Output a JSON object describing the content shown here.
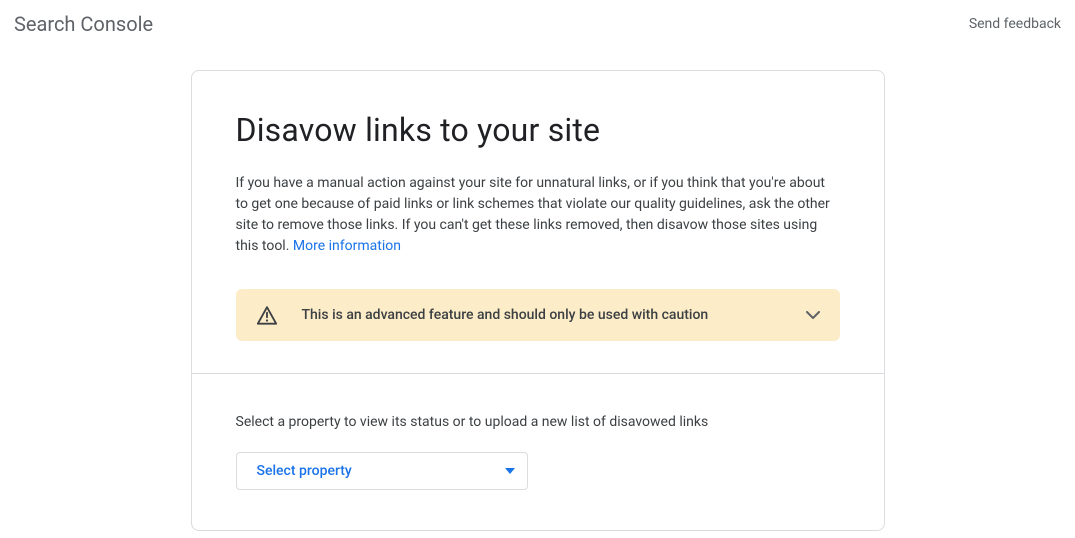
{
  "header": {
    "app_title": "Search Console",
    "feedback_label": "Send feedback"
  },
  "main": {
    "heading": "Disavow links to your site",
    "description": "If you have a manual action against your site for unnatural links, or if you think that you're about to get one because of paid links or link schemes that violate our quality guidelines, ask the other site to remove those links. If you can't get these links removed, then disavow those sites using this tool.",
    "more_info_label": "More information",
    "warning": {
      "text": "This is an advanced feature and should only be used with caution"
    },
    "select": {
      "label": "Select a property to view its status or to upload a new list of disavowed links",
      "placeholder": "Select property"
    }
  },
  "colors": {
    "accent": "#1a73e8",
    "warning_bg": "#fdecc8",
    "border": "#dadce0",
    "text_primary": "#202124",
    "text_secondary": "#5f6368"
  }
}
